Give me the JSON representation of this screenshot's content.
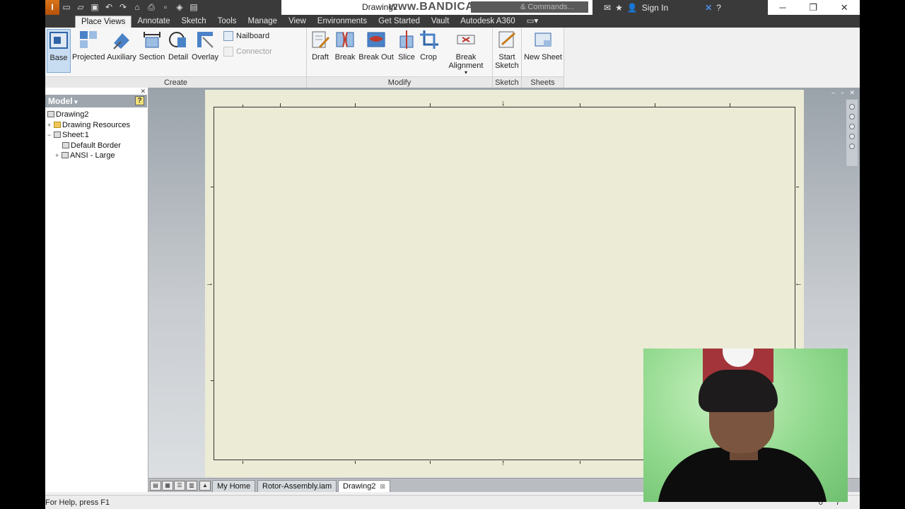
{
  "titlebar": {
    "document_name": "Drawing2",
    "watermark": "www.BANDICAM.com",
    "search_placeholder": "& Commands...",
    "sign_in": "Sign In",
    "app_logo": "I",
    "icons": [
      "new-icon",
      "open-icon",
      "save-icon",
      "undo-icon",
      "redo-icon",
      "home-icon",
      "print-icon"
    ]
  },
  "tabs": [
    "Place Views",
    "Annotate",
    "Sketch",
    "Tools",
    "Manage",
    "View",
    "Environments",
    "Get Started",
    "Vault",
    "Autodesk A360"
  ],
  "active_tab": "Place Views",
  "ribbon": {
    "create": {
      "label": "Create",
      "base": "Base",
      "projected": "Projected",
      "auxiliary": "Auxiliary",
      "section": "Section",
      "detail": "Detail",
      "overlay": "Overlay",
      "nailboard": "Nailboard",
      "connector": "Connector"
    },
    "modify": {
      "label": "Modify",
      "draft": "Draft",
      "break": "Break",
      "break_out": "Break Out",
      "slice": "Slice",
      "crop": "Crop",
      "break_alignment": "Break Alignment"
    },
    "sketch": {
      "label": "Sketch",
      "start_sketch_line1": "Start",
      "start_sketch_line2": "Sketch"
    },
    "sheets": {
      "label": "Sheets",
      "new_sheet": "New Sheet"
    }
  },
  "browser": {
    "title": "Model",
    "help": "?",
    "tree": [
      {
        "label": "Drawing2",
        "level": 0,
        "expander": "",
        "icon": "drawing-icon"
      },
      {
        "label": "Drawing Resources",
        "level": 1,
        "expander": "+",
        "icon": "folder-icon"
      },
      {
        "label": "Sheet:1",
        "level": 1,
        "expander": "−",
        "icon": "sheet-icon"
      },
      {
        "label": "Default Border",
        "level": 2,
        "expander": "",
        "icon": "border-icon"
      },
      {
        "label": "ANSI - Large",
        "level": 2,
        "expander": "+",
        "icon": "titleblock-icon"
      }
    ]
  },
  "doc_tabs": {
    "tabs": [
      "My Home",
      "Rotor-Assembly.iam",
      "Drawing2"
    ],
    "active": "Drawing2",
    "close": "⊠"
  },
  "statusbar": {
    "help_text": "For Help, press F1",
    "count_a": "0",
    "count_b": "7"
  },
  "colors": {
    "sheet": "#ebebd6",
    "ribbon_bg": "#f6f6f6",
    "title_bar": "#3a3a3a",
    "active_button": "#c8ddf2"
  }
}
